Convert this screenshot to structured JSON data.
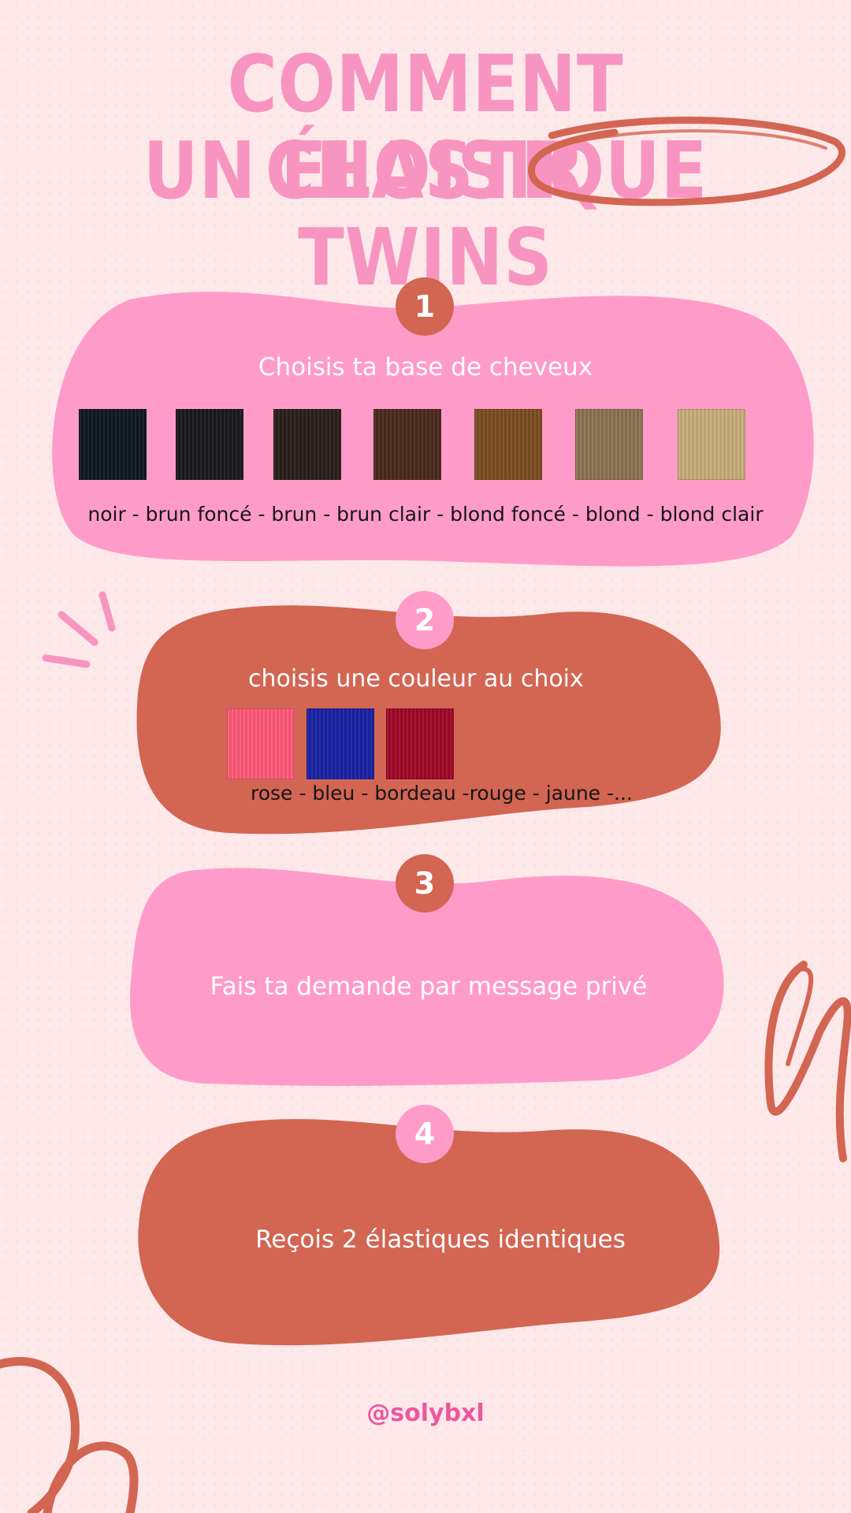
{
  "title": {
    "line1": "COMMENT CHOISIR",
    "line2": "UN ÉLASTIQUE TWINS"
  },
  "steps": [
    {
      "number": "1",
      "heading": "Choisis ta base de cheveux",
      "caption": "noir - brun foncé - brun - brun clair - blond foncé - blond - blond clair",
      "swatches": [
        "#0f1820",
        "#1b1b1d",
        "#2b201b",
        "#4a2b1c",
        "#7d4f22",
        "#8d7454",
        "#c7ad7a"
      ]
    },
    {
      "number": "2",
      "heading": "choisis une couleur au choix",
      "caption": "rose - bleu - bordeau -rouge - jaune  -...",
      "swatches": [
        "#ff5a78",
        "#1a22a6",
        "#a10a28"
      ]
    },
    {
      "number": "3",
      "heading": "Fais ta demande par message privé"
    },
    {
      "number": "4",
      "heading": "Reçois 2 élastiques identiques"
    }
  ],
  "handle": "@solybxl",
  "colors": {
    "background": "#fde9ea",
    "pink": "#ff9bc9",
    "rust": "#d36553",
    "title": "#f795c0",
    "handle": "#ee579f"
  }
}
